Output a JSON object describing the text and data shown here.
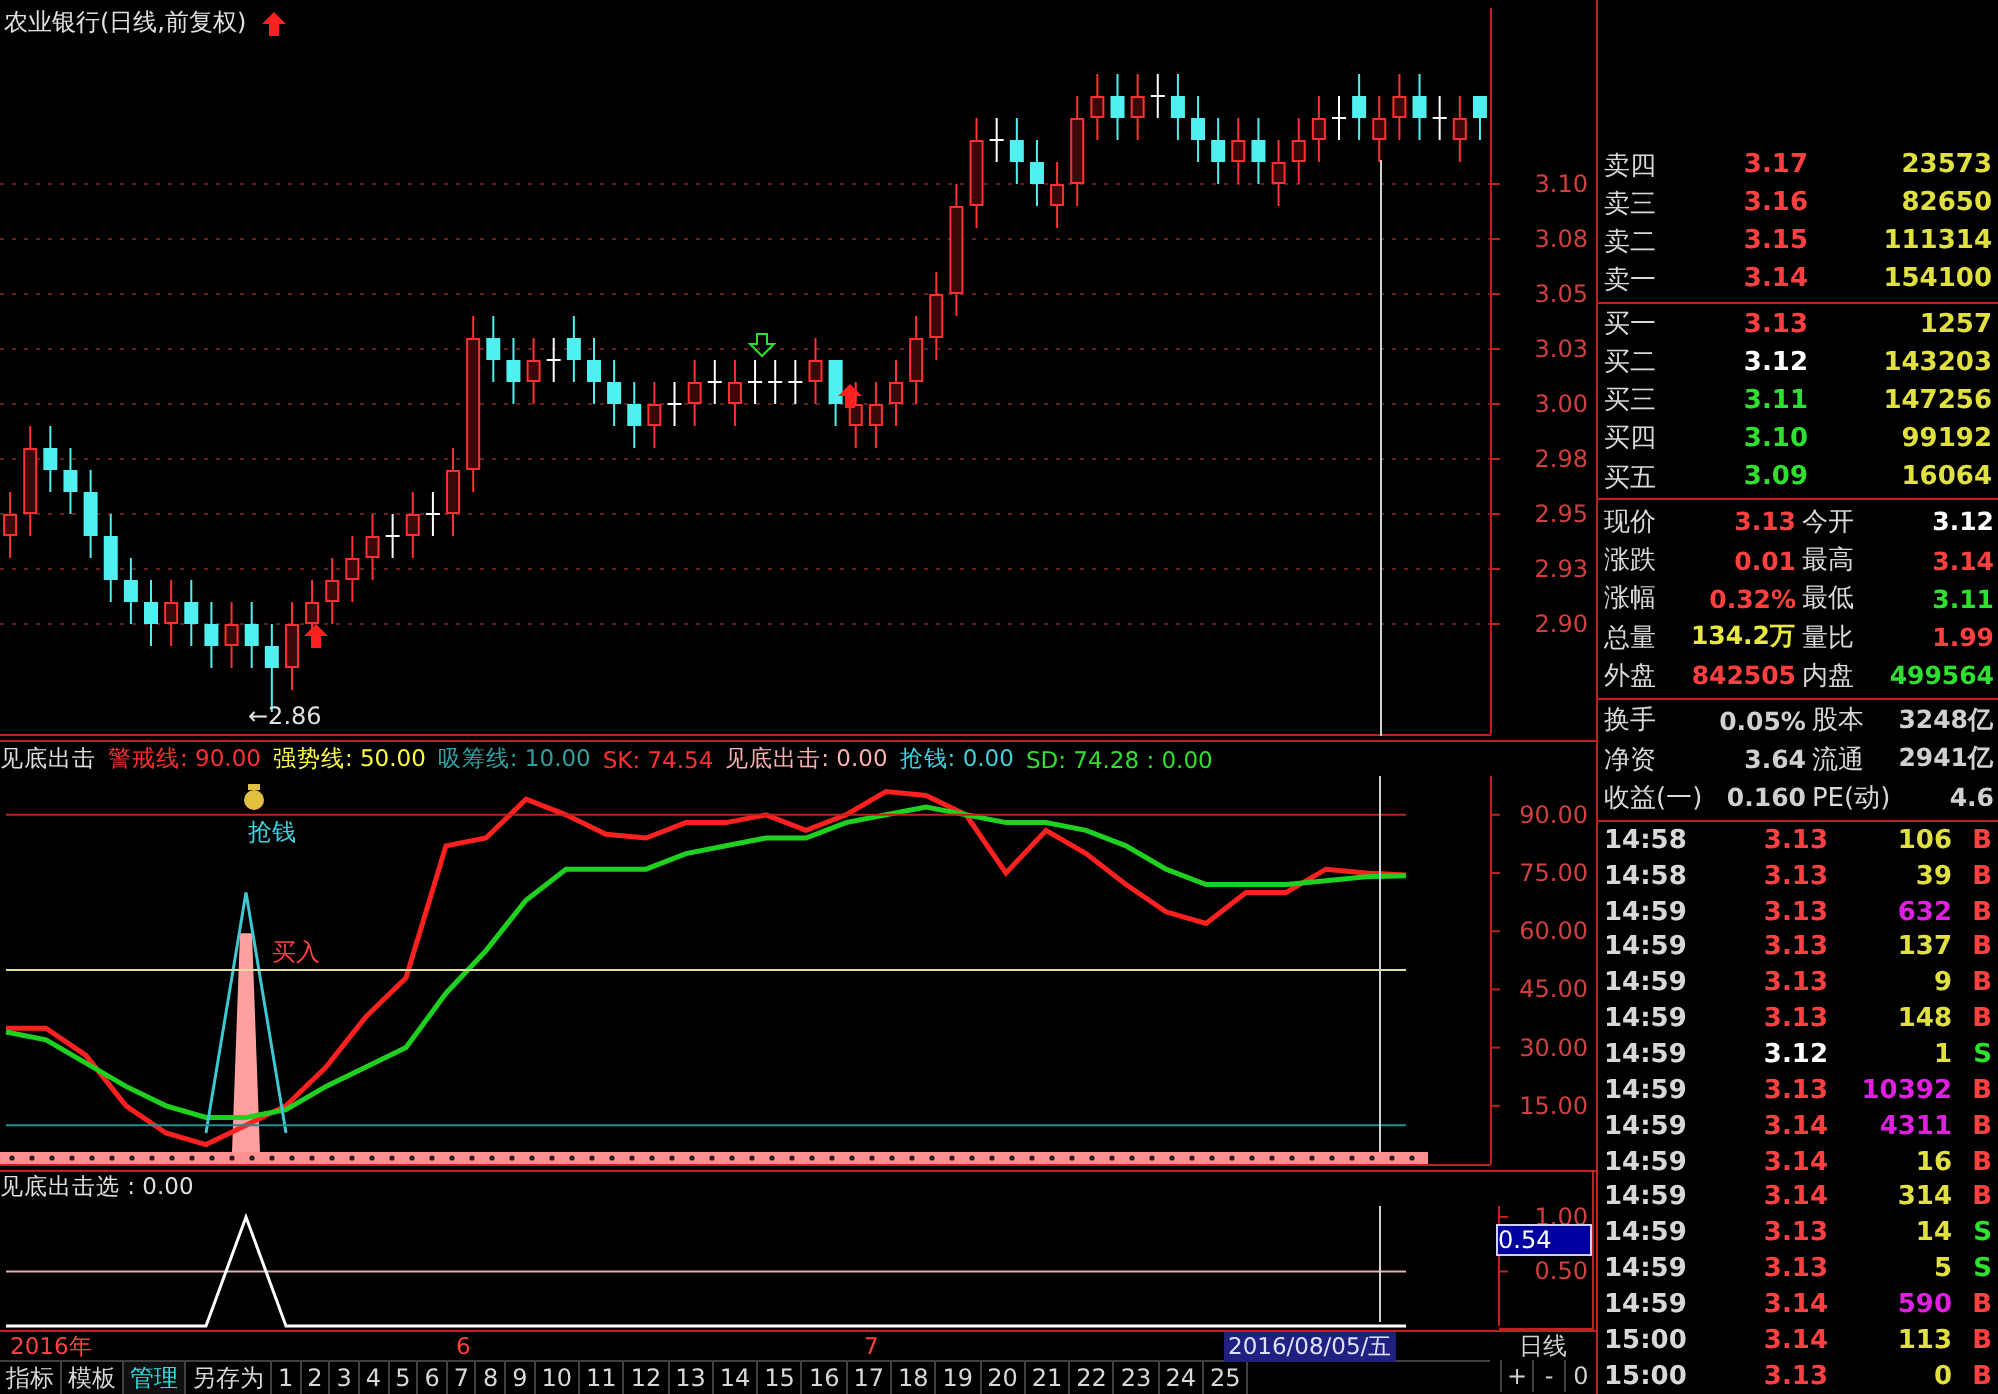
{
  "price_panel": {
    "title": "农业银行(日线,前复权)",
    "low_label": "←2.86",
    "chart_data": {
      "type": "candlestick",
      "ylim": [
        2.85,
        3.18
      ],
      "grid": true,
      "categories": [
        null,
        null,
        null,
        null,
        null,
        null,
        null,
        null,
        null,
        null,
        null,
        null,
        null,
        null,
        null,
        null,
        null,
        null,
        null,
        null,
        null,
        null,
        null,
        null,
        null,
        null,
        null,
        null,
        null,
        null,
        null,
        null,
        null,
        null,
        null,
        null,
        null,
        null,
        null,
        null,
        null,
        null,
        null,
        null,
        null,
        null,
        null,
        null,
        null,
        null,
        null,
        null,
        null,
        null,
        null,
        null,
        null,
        null,
        null,
        null,
        null,
        null,
        null,
        null,
        null,
        null,
        null,
        null,
        null,
        null,
        null,
        null,
        null,
        null
      ],
      "yticks": [
        {
          "value": 3.1,
          "label": "3.10"
        },
        {
          "value": 3.075,
          "label": "3.08"
        },
        {
          "value": 3.05,
          "label": "3.05"
        },
        {
          "value": 3.025,
          "label": "3.03"
        },
        {
          "value": 3.0,
          "label": "3.00"
        },
        {
          "value": 2.975,
          "label": "2.98"
        },
        {
          "value": 2.95,
          "label": "2.95"
        },
        {
          "value": 2.925,
          "label": "2.93"
        },
        {
          "value": 2.9,
          "label": "2.90"
        }
      ],
      "ohlc": [
        [
          2.94,
          2.96,
          2.93,
          2.95
        ],
        [
          2.95,
          2.99,
          2.94,
          2.98
        ],
        [
          2.98,
          2.99,
          2.96,
          2.97
        ],
        [
          2.97,
          2.98,
          2.95,
          2.96
        ],
        [
          2.96,
          2.97,
          2.93,
          2.94
        ],
        [
          2.94,
          2.95,
          2.91,
          2.92
        ],
        [
          2.92,
          2.93,
          2.9,
          2.91
        ],
        [
          2.91,
          2.92,
          2.89,
          2.9
        ],
        [
          2.9,
          2.92,
          2.89,
          2.91
        ],
        [
          2.91,
          2.92,
          2.89,
          2.9
        ],
        [
          2.9,
          2.91,
          2.88,
          2.89
        ],
        [
          2.89,
          2.91,
          2.88,
          2.9
        ],
        [
          2.9,
          2.91,
          2.88,
          2.89
        ],
        [
          2.89,
          2.9,
          2.86,
          2.88
        ],
        [
          2.88,
          2.91,
          2.87,
          2.9
        ],
        [
          2.9,
          2.92,
          2.89,
          2.91
        ],
        [
          2.91,
          2.93,
          2.9,
          2.92
        ],
        [
          2.92,
          2.94,
          2.91,
          2.93
        ],
        [
          2.93,
          2.95,
          2.92,
          2.94
        ],
        [
          2.94,
          2.95,
          2.93,
          2.94
        ],
        [
          2.94,
          2.96,
          2.93,
          2.95
        ],
        [
          2.95,
          2.96,
          2.94,
          2.95
        ],
        [
          2.95,
          2.98,
          2.94,
          2.97
        ],
        [
          2.97,
          3.04,
          2.96,
          3.03
        ],
        [
          3.03,
          3.04,
          3.01,
          3.02
        ],
        [
          3.02,
          3.03,
          3.0,
          3.01
        ],
        [
          3.01,
          3.03,
          3.0,
          3.02
        ],
        [
          3.02,
          3.03,
          3.01,
          3.02
        ],
        [
          3.03,
          3.04,
          3.01,
          3.02
        ],
        [
          3.02,
          3.03,
          3.0,
          3.01
        ],
        [
          3.01,
          3.02,
          2.99,
          3.0
        ],
        [
          3.0,
          3.01,
          2.98,
          2.99
        ],
        [
          2.99,
          3.01,
          2.98,
          3.0
        ],
        [
          3.0,
          3.01,
          2.99,
          3.0
        ],
        [
          3.0,
          3.02,
          2.99,
          3.01
        ],
        [
          3.01,
          3.02,
          3.0,
          3.01
        ],
        [
          3.0,
          3.02,
          2.99,
          3.01
        ],
        [
          3.01,
          3.02,
          3.0,
          3.01
        ],
        [
          3.01,
          3.02,
          3.0,
          3.01
        ],
        [
          3.01,
          3.02,
          3.0,
          3.01
        ],
        [
          3.01,
          3.03,
          3.0,
          3.02
        ],
        [
          3.02,
          3.02,
          2.99,
          3.0
        ],
        [
          2.99,
          3.01,
          2.98,
          3.0
        ],
        [
          2.99,
          3.01,
          2.98,
          3.0
        ],
        [
          3.0,
          3.02,
          2.99,
          3.01
        ],
        [
          3.01,
          3.04,
          3.0,
          3.03
        ],
        [
          3.03,
          3.06,
          3.02,
          3.05
        ],
        [
          3.05,
          3.1,
          3.04,
          3.09
        ],
        [
          3.09,
          3.13,
          3.08,
          3.12
        ],
        [
          3.12,
          3.13,
          3.11,
          3.12
        ],
        [
          3.12,
          3.13,
          3.1,
          3.11
        ],
        [
          3.11,
          3.12,
          3.09,
          3.1
        ],
        [
          3.09,
          3.11,
          3.08,
          3.1
        ],
        [
          3.1,
          3.14,
          3.09,
          3.13
        ],
        [
          3.13,
          3.15,
          3.12,
          3.14
        ],
        [
          3.14,
          3.15,
          3.12,
          3.13
        ],
        [
          3.13,
          3.15,
          3.12,
          3.14
        ],
        [
          3.14,
          3.15,
          3.13,
          3.14
        ],
        [
          3.14,
          3.15,
          3.12,
          3.13
        ],
        [
          3.13,
          3.14,
          3.11,
          3.12
        ],
        [
          3.12,
          3.13,
          3.1,
          3.11
        ],
        [
          3.11,
          3.13,
          3.1,
          3.12
        ],
        [
          3.12,
          3.13,
          3.1,
          3.11
        ],
        [
          3.1,
          3.12,
          3.09,
          3.11
        ],
        [
          3.11,
          3.13,
          3.1,
          3.12
        ],
        [
          3.12,
          3.14,
          3.11,
          3.13
        ],
        [
          3.13,
          3.14,
          3.12,
          3.13
        ],
        [
          3.14,
          3.15,
          3.12,
          3.13
        ],
        [
          3.12,
          3.14,
          3.11,
          3.13
        ],
        [
          3.13,
          3.15,
          3.12,
          3.14
        ],
        [
          3.14,
          3.15,
          3.12,
          3.13
        ],
        [
          3.13,
          3.14,
          3.12,
          3.13
        ],
        [
          3.12,
          3.14,
          3.11,
          3.13
        ],
        [
          3.14,
          3.14,
          3.12,
          3.13
        ]
      ]
    }
  },
  "indicator": {
    "legend": [
      {
        "text": "见底出击",
        "color": "#e0e0e0"
      },
      {
        "text": "警戒线: 90.00",
        "color": "#ff3030"
      },
      {
        "text": "强势线: 50.00",
        "color": "#ffff40"
      },
      {
        "text": "吸筹线: 10.00",
        "color": "#30a0a0"
      },
      {
        "text": "SK: 74.54",
        "color": "#ff3030"
      },
      {
        "text": "见底出击: 0.00",
        "color": "#ffb0b0"
      },
      {
        "text": "抢钱: 0.00",
        "color": "#40d0e0"
      },
      {
        "text": "SD: 74.28 : 0.00",
        "color": "#30e030"
      }
    ],
    "signal_labels": [
      "抢钱",
      "买入"
    ],
    "chart_data": {
      "type": "line",
      "ylim": [
        0,
        100
      ],
      "yticks": [
        {
          "value": 90,
          "label": "90.00"
        },
        {
          "value": 75,
          "label": "75.00"
        },
        {
          "value": 60,
          "label": "60.00"
        },
        {
          "value": 45,
          "label": "45.00"
        },
        {
          "value": 30,
          "label": "30.00"
        },
        {
          "value": 15,
          "label": "15.00"
        }
      ],
      "series": [
        {
          "color": "#ff2020",
          "values": [
            35,
            35,
            28,
            15,
            8,
            5,
            10,
            15,
            25,
            38,
            48,
            82,
            84,
            94,
            90,
            85,
            84,
            88,
            88,
            90,
            86,
            90,
            96,
            95,
            90,
            75,
            86,
            80,
            72,
            65,
            62,
            70,
            70,
            76,
            75,
            74.5
          ]
        },
        {
          "color": "#20d020",
          "values": [
            34,
            32,
            26,
            20,
            15,
            12,
            12,
            14,
            20,
            25,
            30,
            44,
            55,
            68,
            76,
            76,
            76,
            80,
            82,
            84,
            84,
            88,
            90,
            92,
            90,
            88,
            88,
            86,
            82,
            76,
            72,
            72,
            72,
            73,
            74,
            74.3
          ]
        },
        {
          "color": "#40c8d0",
          "values": [
            null,
            null,
            null,
            null,
            null,
            8,
            70,
            8,
            null,
            null,
            null,
            null,
            null,
            null,
            null,
            null,
            null,
            null,
            null,
            null,
            null,
            null,
            null,
            null,
            null,
            null,
            null,
            null,
            null,
            null,
            null,
            null,
            null,
            null,
            null,
            null
          ]
        },
        {
          "color": "#c02020",
          "values": [
            90,
            90,
            90,
            90,
            90,
            90,
            90,
            90,
            90,
            90,
            90,
            90,
            90,
            90,
            90,
            90,
            90,
            90,
            90,
            90,
            90,
            90,
            90,
            90,
            90,
            90,
            90,
            90,
            90,
            90,
            90,
            90,
            90,
            90,
            90,
            90
          ]
        },
        {
          "color": "#e0e0a0",
          "values": [
            50,
            50,
            50,
            50,
            50,
            50,
            50,
            50,
            50,
            50,
            50,
            50,
            50,
            50,
            50,
            50,
            50,
            50,
            50,
            50,
            50,
            50,
            50,
            50,
            50,
            50,
            50,
            50,
            50,
            50,
            50,
            50,
            50,
            50,
            50,
            50
          ]
        },
        {
          "color": "#209090",
          "values": [
            10,
            10,
            10,
            10,
            10,
            10,
            10,
            10,
            10,
            10,
            10,
            10,
            10,
            10,
            10,
            10,
            10,
            10,
            10,
            10,
            10,
            10,
            10,
            10,
            10,
            10,
            10,
            10,
            10,
            10,
            10,
            10,
            10,
            10,
            10,
            10
          ]
        }
      ]
    }
  },
  "lower": {
    "legend": "见底出击选 : 0.00",
    "cursor_value": "0.54",
    "chart_data": {
      "type": "line",
      "ylim": [
        0,
        1.1
      ],
      "yticks": [
        {
          "value": 1,
          "label": "1.00"
        },
        {
          "value": 0.5,
          "label": "0.50"
        }
      ],
      "series": [
        {
          "color": "#e0b0b0",
          "values": [
            0.5,
            0.5,
            0.5,
            0.5,
            0.5,
            0.5,
            0.5,
            0.5,
            0.5,
            0.5,
            0.5,
            0.5,
            0.5,
            0.5,
            0.5,
            0.5,
            0.5,
            0.5,
            0.5,
            0.5,
            0.5,
            0.5,
            0.5,
            0.5,
            0.5,
            0.5,
            0.5,
            0.5,
            0.5,
            0.5,
            0.5,
            0.5,
            0.5,
            0.5,
            0.5,
            0.5
          ]
        },
        {
          "color": "#ffffff",
          "values": [
            0,
            0,
            0,
            0,
            0,
            0,
            1,
            0,
            0,
            0,
            0,
            0,
            0,
            0,
            0,
            0,
            0,
            0,
            0,
            0,
            0,
            0,
            0,
            0,
            0,
            0,
            0,
            0,
            0,
            0,
            0,
            0,
            0,
            0,
            0,
            0
          ]
        }
      ]
    }
  },
  "date_axis": {
    "labels": [
      "2016年",
      "6",
      "7"
    ],
    "cursor_date": "2016/08/05/五",
    "period": "日线"
  },
  "bottom_tabs": [
    {
      "label": "指标",
      "selected": false
    },
    {
      "label": "模板",
      "selected": false
    },
    {
      "label": "管理",
      "selected": true
    },
    {
      "label": "另存为",
      "selected": false
    },
    {
      "label": "1",
      "selected": false
    },
    {
      "label": "2",
      "selected": false
    },
    {
      "label": "3",
      "selected": false
    },
    {
      "label": "4",
      "selected": false
    },
    {
      "label": "5",
      "selected": false
    },
    {
      "label": "6",
      "selected": false
    },
    {
      "label": "7",
      "selected": false
    },
    {
      "label": "8",
      "selected": false
    },
    {
      "label": "9",
      "selected": false
    },
    {
      "label": "10",
      "selected": false
    },
    {
      "label": "11",
      "selected": false
    },
    {
      "label": "12",
      "selected": false
    },
    {
      "label": "13",
      "selected": false
    },
    {
      "label": "14",
      "selected": false
    },
    {
      "label": "15",
      "selected": false
    },
    {
      "label": "16",
      "selected": false
    },
    {
      "label": "17",
      "selected": false
    },
    {
      "label": "18",
      "selected": false
    },
    {
      "label": "19",
      "selected": false
    },
    {
      "label": "20",
      "selected": false
    },
    {
      "label": "21",
      "selected": false
    },
    {
      "label": "22",
      "selected": false
    },
    {
      "label": "23",
      "selected": false
    },
    {
      "label": "24",
      "selected": false
    },
    {
      "label": "25",
      "selected": false
    }
  ],
  "zoom_buttons": [
    "+",
    "-",
    "0"
  ],
  "order_book": {
    "asks": [
      {
        "label": "卖四",
        "price": "3.17",
        "volume": "23573",
        "color": "#ff4040"
      },
      {
        "label": "卖三",
        "price": "3.16",
        "volume": "82650",
        "color": "#ff4040"
      },
      {
        "label": "卖二",
        "price": "3.15",
        "volume": "111314",
        "color": "#ff4040"
      },
      {
        "label": "卖一",
        "price": "3.14",
        "volume": "154100",
        "color": "#ff4040"
      }
    ],
    "bids": [
      {
        "label": "买一",
        "price": "3.13",
        "volume": "1257",
        "color": "#ff4040"
      },
      {
        "label": "买二",
        "price": "3.12",
        "volume": "143203",
        "color": "#ffffff"
      },
      {
        "label": "买三",
        "price": "3.11",
        "volume": "147256",
        "color": "#30e030"
      },
      {
        "label": "买四",
        "price": "3.10",
        "volume": "99192",
        "color": "#30e030"
      },
      {
        "label": "买五",
        "price": "3.09",
        "volume": "16064",
        "color": "#30e030"
      }
    ]
  },
  "quote": [
    {
      "label": "现价",
      "value": "3.13",
      "color": "#ff4040"
    },
    {
      "label": "今开",
      "value": "3.12",
      "color": "#ffffff"
    },
    {
      "label": "涨跌",
      "value": "0.01",
      "color": "#ff4040"
    },
    {
      "label": "最高",
      "value": "3.14",
      "color": "#ff4040"
    },
    {
      "label": "涨幅",
      "value": "0.32%",
      "color": "#ff4040"
    },
    {
      "label": "最低",
      "value": "3.11",
      "color": "#30e030"
    },
    {
      "label": "总量",
      "value": "134.2万",
      "color": "#e8e840"
    },
    {
      "label": "量比",
      "value": "1.99",
      "color": "#ff4040"
    },
    {
      "label": "外盘",
      "value": "842505",
      "color": "#ff4040"
    },
    {
      "label": "内盘",
      "value": "499564",
      "color": "#30e030"
    }
  ],
  "fundamentals": [
    {
      "label": "换手",
      "value": "0.05%"
    },
    {
      "label": "股本",
      "value": "3248亿"
    },
    {
      "label": "净资",
      "value": "3.64"
    },
    {
      "label": "流通",
      "value": "2941亿"
    },
    {
      "label": "收益(一)",
      "value": "0.160"
    },
    {
      "label": "PE(动)",
      "value": "4.6"
    }
  ],
  "ticks": [
    {
      "time": "14:58",
      "price": "3.13",
      "color": "#ff4040",
      "volume": "106",
      "large": false,
      "side": "B",
      "sell": false
    },
    {
      "time": "14:58",
      "price": "3.13",
      "color": "#ff4040",
      "volume": "39",
      "large": false,
      "side": "B",
      "sell": false
    },
    {
      "time": "14:59",
      "price": "3.13",
      "color": "#ff4040",
      "volume": "632",
      "large": true,
      "side": "B",
      "sell": false
    },
    {
      "time": "14:59",
      "price": "3.13",
      "color": "#ff4040",
      "volume": "137",
      "large": false,
      "side": "B",
      "sell": false
    },
    {
      "time": "14:59",
      "price": "3.13",
      "color": "#ff4040",
      "volume": "9",
      "large": false,
      "side": "B",
      "sell": false
    },
    {
      "time": "14:59",
      "price": "3.13",
      "color": "#ff4040",
      "volume": "148",
      "large": false,
      "side": "B",
      "sell": false
    },
    {
      "time": "14:59",
      "price": "3.12",
      "color": "#ffffff",
      "volume": "1",
      "large": false,
      "side": "S",
      "sell": true
    },
    {
      "time": "14:59",
      "price": "3.13",
      "color": "#ff4040",
      "volume": "10392",
      "large": true,
      "side": "B",
      "sell": false
    },
    {
      "time": "14:59",
      "price": "3.14",
      "color": "#ff4040",
      "volume": "4311",
      "large": true,
      "side": "B",
      "sell": false
    },
    {
      "time": "14:59",
      "price": "3.14",
      "color": "#ff4040",
      "volume": "16",
      "large": false,
      "side": "B",
      "sell": false
    },
    {
      "time": "14:59",
      "price": "3.14",
      "color": "#ff4040",
      "volume": "314",
      "large": false,
      "side": "B",
      "sell": false
    },
    {
      "time": "14:59",
      "price": "3.13",
      "color": "#ff4040",
      "volume": "14",
      "large": false,
      "side": "S",
      "sell": true
    },
    {
      "time": "14:59",
      "price": "3.13",
      "color": "#ff4040",
      "volume": "5",
      "large": false,
      "side": "S",
      "sell": true
    },
    {
      "time": "14:59",
      "price": "3.14",
      "color": "#ff4040",
      "volume": "590",
      "large": true,
      "side": "B",
      "sell": false
    },
    {
      "time": "15:00",
      "price": "3.14",
      "color": "#ff4040",
      "volume": "113",
      "large": false,
      "side": "B",
      "sell": false
    },
    {
      "time": "15:00",
      "price": "3.13",
      "color": "#ff4040",
      "volume": "0",
      "large": false,
      "side": "B",
      "sell": false
    }
  ]
}
